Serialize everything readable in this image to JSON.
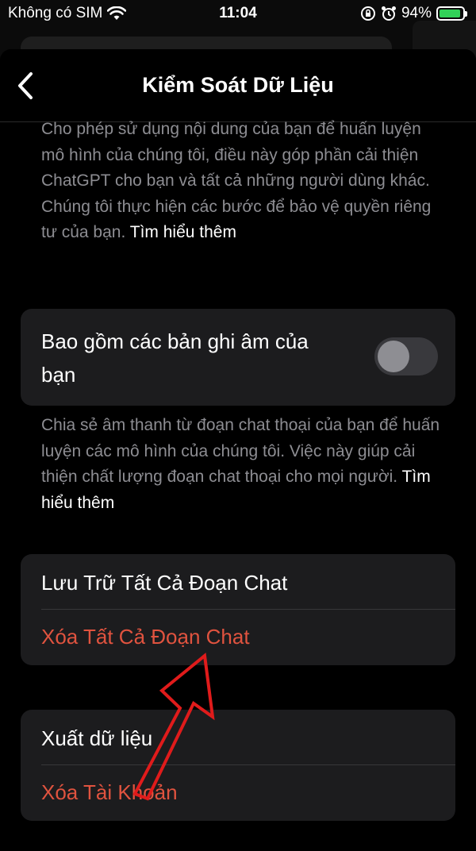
{
  "status_bar": {
    "carrier": "Không có SIM",
    "time": "11:04",
    "battery_percent": "94%",
    "battery_level": 0.94,
    "battery_color": "#31d158"
  },
  "nav": {
    "title": "Kiểm Soát Dữ Liệu",
    "back_icon": "chevron-left-icon"
  },
  "training_section": {
    "description": "Cho phép sử dụng nội dung của bạn để huấn luyện mô hình của chúng tôi, điều này góp phần cải thiện ChatGPT cho bạn và tất cả những người dùng khác. Chúng tôi thực hiện các bước để bảo vệ quyền riêng tư của bạn.",
    "link": "Tìm hiểu thêm"
  },
  "voice_section": {
    "toggle_label": "Bao gồm các bản ghi âm của bạn",
    "toggle_on": false,
    "description": "Chia sẻ âm thanh từ đoạn chat thoại của bạn để huấn luyện các mô hình của chúng tôi. Việc này giúp cải thiện chất lượng đoạn chat thoại cho mọi người.",
    "link": "Tìm hiểu thêm"
  },
  "chat_actions": {
    "archive_all": "Lưu Trữ Tất Cả Đoạn Chat",
    "delete_all": "Xóa Tất Cả Đoạn Chat"
  },
  "account_actions": {
    "export_data": "Xuất dữ liệu",
    "delete_account": "Xóa Tài Khoản"
  },
  "colors": {
    "destructive": "#e0533f",
    "annotation_arrow": "#e01b1b"
  }
}
